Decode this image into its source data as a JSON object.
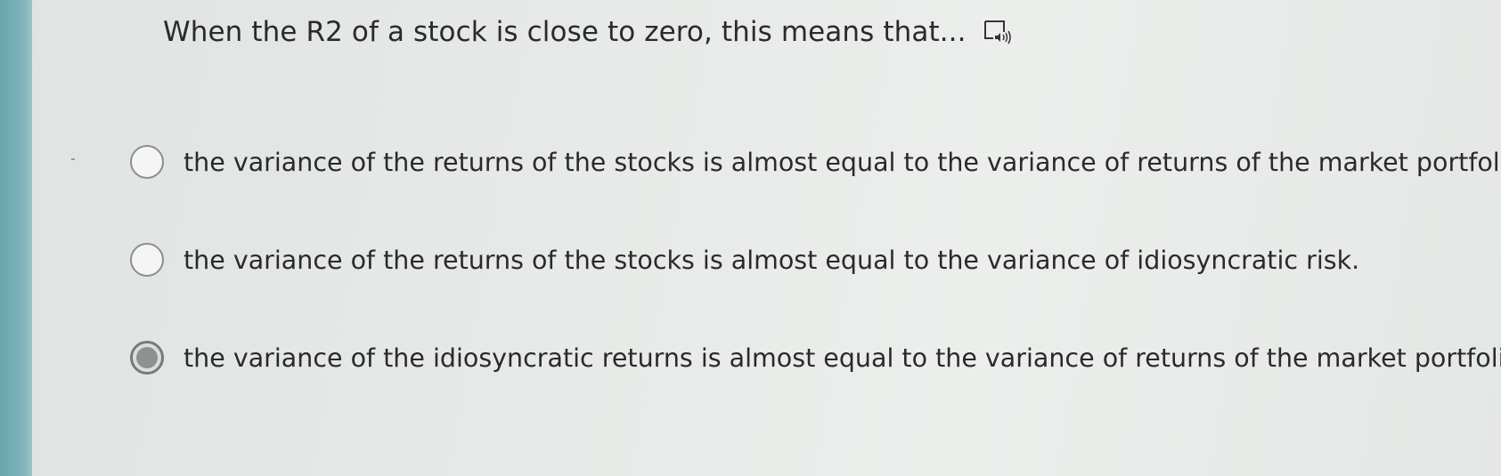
{
  "question": {
    "text": "When the R2 of a stock is close to zero, this means that...",
    "audio_icon": "speaker-box-icon"
  },
  "options": [
    {
      "label": "the variance of the returns of the stocks is almost equal to the variance of returns of the market portfolio.",
      "selected": false
    },
    {
      "label": "the variance of the returns of the stocks is almost equal to the variance of idiosyncratic risk.",
      "selected": false
    },
    {
      "label": "the variance of the idiosyncratic returns is almost equal to the variance of returns of the market portfolio.",
      "selected": true
    }
  ],
  "colors": {
    "accent_strip": "#7fb4b9",
    "background": "#e8eae8",
    "text": "#2a2a2a",
    "radio_selected": "#8e9190"
  }
}
